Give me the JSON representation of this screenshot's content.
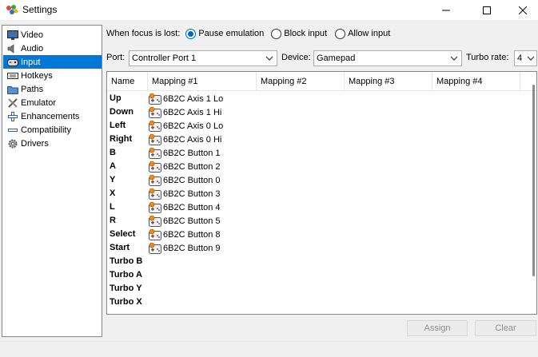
{
  "window": {
    "title": "Settings",
    "minimize": "—",
    "maximize": "☐",
    "close": "✕"
  },
  "sidebar": {
    "items": [
      {
        "label": "Video",
        "icon": "monitor-icon"
      },
      {
        "label": "Audio",
        "icon": "speaker-icon"
      },
      {
        "label": "Input",
        "icon": "gamepad-icon",
        "selected": true
      },
      {
        "label": "Hotkeys",
        "icon": "keyboard-icon"
      },
      {
        "label": "Paths",
        "icon": "folder-icon"
      },
      {
        "label": "Emulator",
        "icon": "tools-icon"
      },
      {
        "label": "Enhancements",
        "icon": "plus-icon"
      },
      {
        "label": "Compatibility",
        "icon": "minus-icon"
      },
      {
        "label": "Drivers",
        "icon": "gear-icon"
      }
    ]
  },
  "focus": {
    "label": "When focus is lost:",
    "options": [
      {
        "label": "Pause emulation",
        "checked": true
      },
      {
        "label": "Block input",
        "checked": false
      },
      {
        "label": "Allow input",
        "checked": false
      }
    ]
  },
  "selectors": {
    "port_label": "Port:",
    "port_value": "Controller Port 1",
    "device_label": "Device:",
    "device_value": "Gamepad",
    "turbo_label": "Turbo rate:",
    "turbo_value": "4"
  },
  "table": {
    "columns": [
      "Name",
      "Mapping #1",
      "Mapping #2",
      "Mapping #3",
      "Mapping #4"
    ],
    "rows": [
      {
        "name": "Up",
        "mapping": "6B2C Axis 1 Lo"
      },
      {
        "name": "Down",
        "mapping": "6B2C Axis 1 Hi"
      },
      {
        "name": "Left",
        "mapping": "6B2C Axis 0 Lo"
      },
      {
        "name": "Right",
        "mapping": "6B2C Axis 0 Hi"
      },
      {
        "name": "B",
        "mapping": "6B2C Button 1"
      },
      {
        "name": "A",
        "mapping": "6B2C Button 2"
      },
      {
        "name": "Y",
        "mapping": "6B2C Button 0"
      },
      {
        "name": "X",
        "mapping": "6B2C Button 3"
      },
      {
        "name": "L",
        "mapping": "6B2C Button 4"
      },
      {
        "name": "R",
        "mapping": "6B2C Button 5"
      },
      {
        "name": "Select",
        "mapping": "6B2C Button 8"
      },
      {
        "name": "Start",
        "mapping": "6B2C Button 9"
      },
      {
        "name": "Turbo B",
        "mapping": ""
      },
      {
        "name": "Turbo A",
        "mapping": ""
      },
      {
        "name": "Turbo Y",
        "mapping": ""
      },
      {
        "name": "Turbo X",
        "mapping": ""
      }
    ]
  },
  "buttons": {
    "assign": "Assign",
    "clear": "Clear"
  },
  "colors": {
    "selection": "#0078d7",
    "radio_accent": "#0067c0"
  }
}
